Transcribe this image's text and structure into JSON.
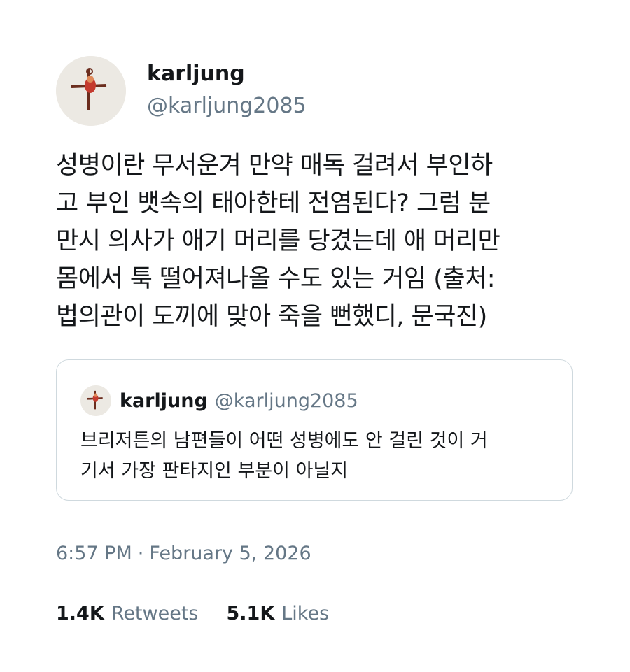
{
  "tweet": {
    "author": {
      "display_name": "karljung",
      "handle": "@karljung2085",
      "avatar_icon": "avatar-figure-icon"
    },
    "text": "성병이란 무서운겨 만약 매독 걸려서 부인하\n고 부인 뱃속의 태아한테 전염된다? 그럼 분\n만시 의사가 애기 머리를 당겼는데 애 머리만\n몸에서 툭 떨어져나올 수도 있는 거임 (출처:\n법의관이 도끼에 맞아 죽을 뻔했디, 문국진)",
    "quoted": {
      "display_name": "karljung",
      "handle": "@karljung2085",
      "text": "브리저튼의 남편들이 어떤 성병에도 안 걸린 것이 거\n기서 가장 판타지인 부분이 아닐지"
    },
    "time": "6:57 PM",
    "separator": "·",
    "date": "February 5, 2026",
    "stats": {
      "retweets_count": "1.4K",
      "retweets_label": "Retweets",
      "likes_count": "5.1K",
      "likes_label": "Likes"
    }
  },
  "colors": {
    "primary_text": "#14171a",
    "secondary_text": "#657786",
    "border": "#cfd9de",
    "background": "#ffffff"
  }
}
